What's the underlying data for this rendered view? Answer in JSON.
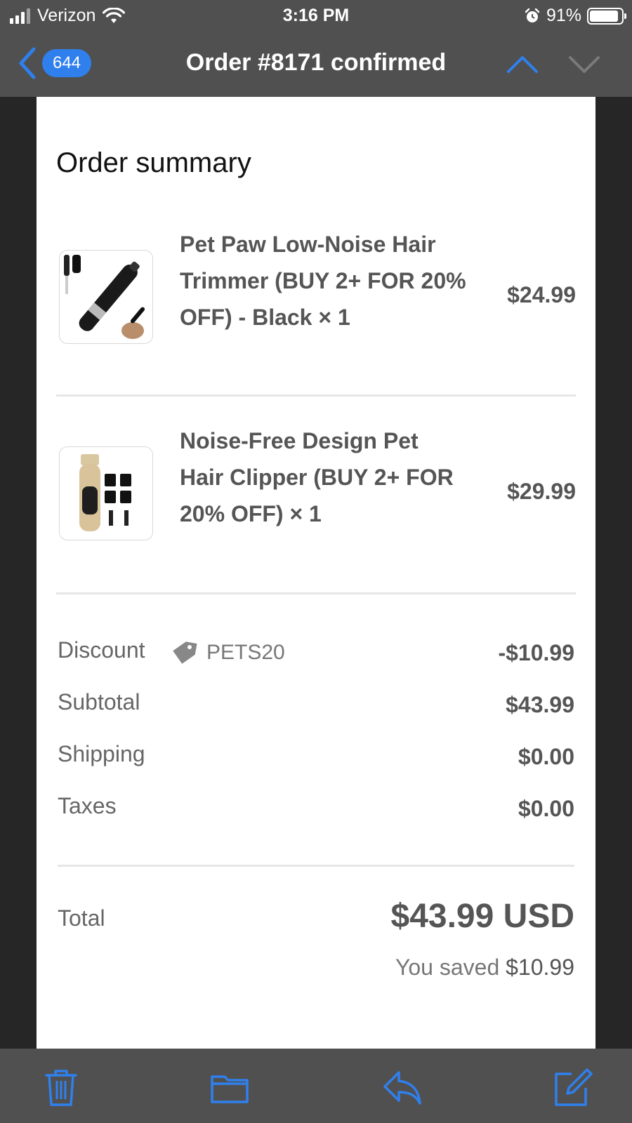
{
  "status_bar": {
    "carrier": "Verizon",
    "time": "3:16 PM",
    "battery_percent": "91%",
    "battery_level": 0.91,
    "icons": [
      "signal-icon",
      "wifi-icon",
      "alarm-icon",
      "battery-icon"
    ]
  },
  "nav": {
    "back_count": "644",
    "title": "Order #8171 confirmed",
    "icons": [
      "chevron-left-icon",
      "chevron-up-icon",
      "chevron-down-icon"
    ]
  },
  "order": {
    "heading": "Order summary",
    "items": [
      {
        "name": "Pet Paw Low-Noise Hair Trimmer (BUY 2+ FOR 20% OFF) - Black × 1",
        "price": "$24.99",
        "image": "trimmer-image"
      },
      {
        "name": "Noise-Free Design Pet Hair Clipper (BUY 2+ FOR 20% OFF) × 1",
        "price": "$29.99",
        "image": "clipper-image"
      }
    ],
    "discount": {
      "label": "Discount",
      "code": "PETS20",
      "value": "-$10.99",
      "icon": "tag-icon"
    },
    "subtotal": {
      "label": "Subtotal",
      "value": "$43.99"
    },
    "shipping": {
      "label": "Shipping",
      "value": "$0.00"
    },
    "taxes": {
      "label": "Taxes",
      "value": "$0.00"
    },
    "total": {
      "label": "Total",
      "value": "$43.99 USD"
    },
    "saved": {
      "prefix": "You saved",
      "amount": "$10.99"
    }
  },
  "toolbar": {
    "icons": [
      "trash-icon",
      "folder-icon",
      "reply-icon",
      "compose-icon"
    ]
  },
  "colors": {
    "accent": "#2f80ed",
    "bar_bg": "#505050",
    "page_bg": "#262626"
  }
}
